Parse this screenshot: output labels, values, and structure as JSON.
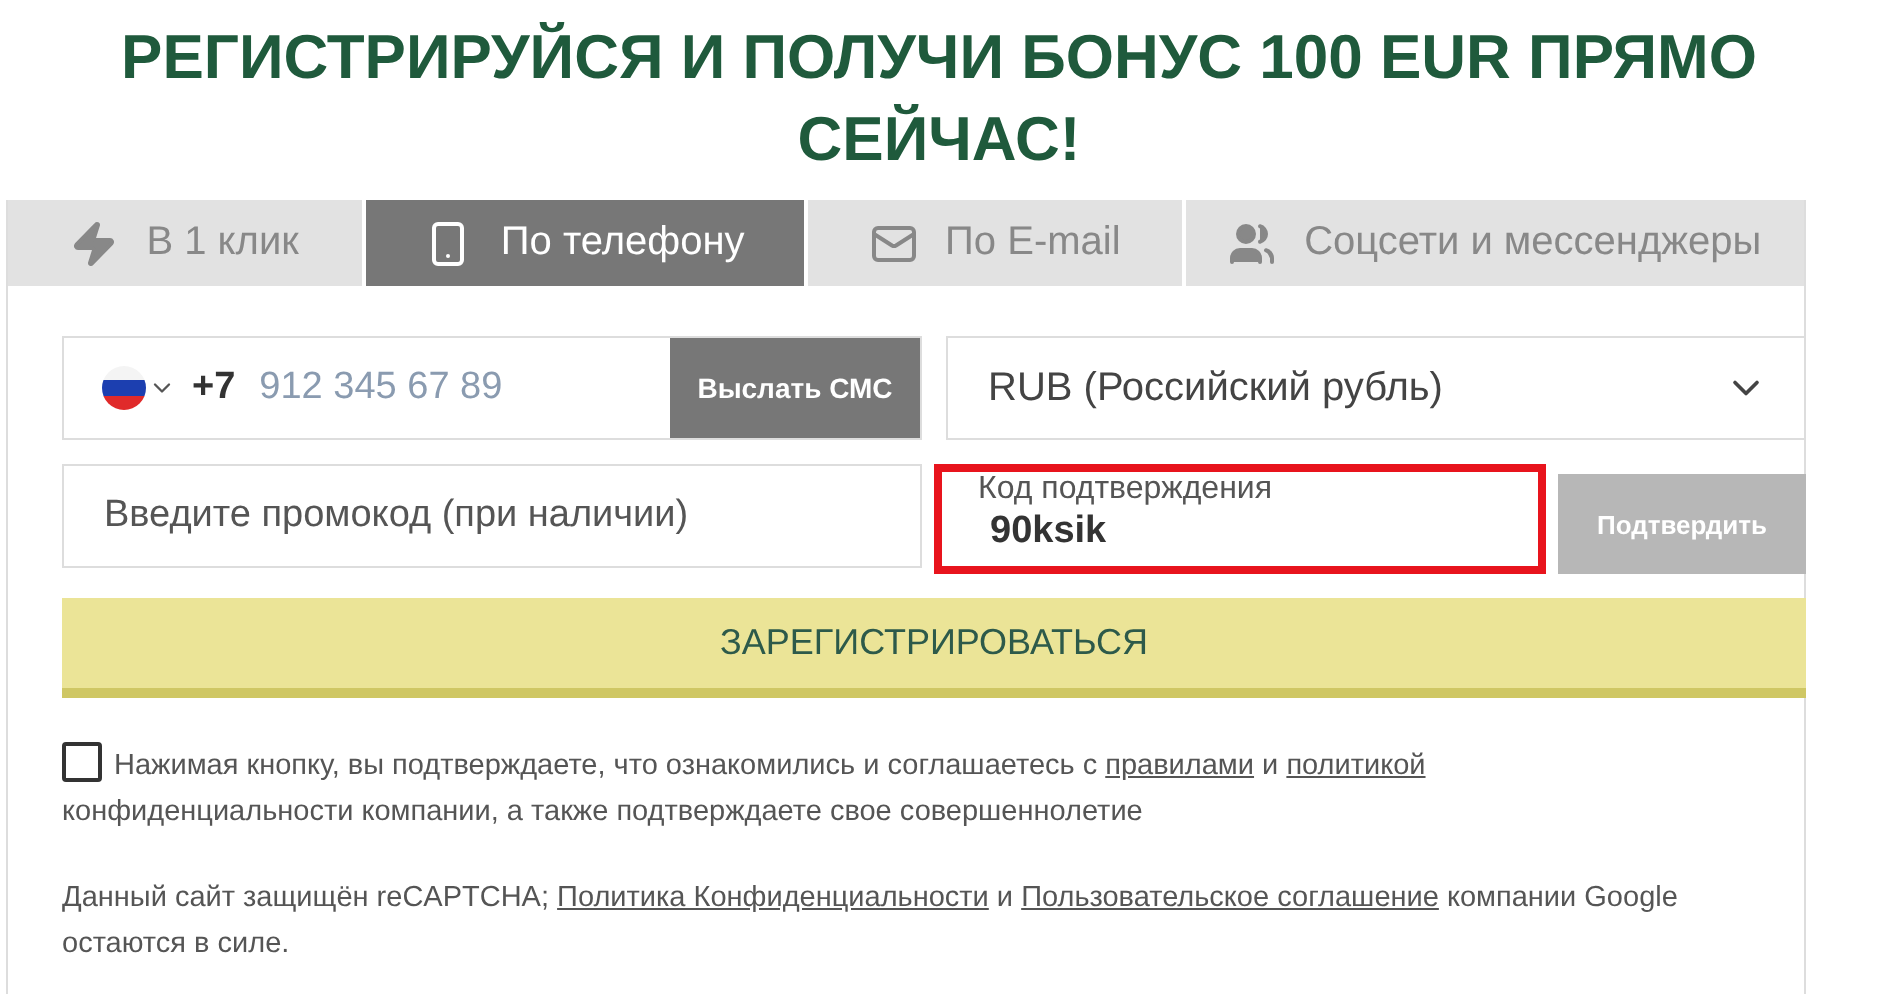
{
  "heading": "РЕГИСТРИРУЙСЯ И ПОЛУЧИ БОНУС 100 EUR ПРЯМО СЕЙЧАС!",
  "tabs": [
    {
      "label": "В 1 клик",
      "kind": "bolt",
      "selected": false
    },
    {
      "label": "По телефону",
      "kind": "phone",
      "selected": true
    },
    {
      "label": "По E-mail",
      "kind": "mail",
      "selected": false
    },
    {
      "label": "Соцсети и мессенджеры",
      "kind": "users",
      "selected": false
    }
  ],
  "phone": {
    "code": "+7",
    "placeholder": "912 345 67 89",
    "button": "Выслать СМС"
  },
  "currency": {
    "value": "RUB (Российский рубль)"
  },
  "promo": {
    "placeholder": "Введите промокод (при наличии)"
  },
  "confirm": {
    "label": "Код подтверждения",
    "value": "90ksik",
    "highlighted": true,
    "button": "Подтвердить"
  },
  "register": "ЗАРЕГИСТРИРОВАТЬСЯ",
  "consent": {
    "checked": false,
    "parts": [
      {
        "kind": "text",
        "text": "Нажимая кнопку, вы подтверждаете, что ознакомились и соглашаетесь с "
      },
      {
        "kind": "link",
        "text": "правилами"
      },
      {
        "kind": "text",
        "text": " и "
      },
      {
        "kind": "link",
        "text": "политикой"
      },
      {
        "kind": "text",
        "text": " конфиденциальности компании, а также подтверждаете свое совершеннолетие"
      }
    ]
  },
  "recaptcha": [
    {
      "kind": "text",
      "text": "Данный сайт защищён reCAPTCHA; "
    },
    {
      "kind": "link",
      "text": "Политика Конфиденциальности"
    },
    {
      "kind": "text",
      "text": " и "
    },
    {
      "kind": "link",
      "text": "Пользовательское соглашение"
    },
    {
      "kind": "text",
      "text": " компании Google остаются в силе."
    }
  ]
}
